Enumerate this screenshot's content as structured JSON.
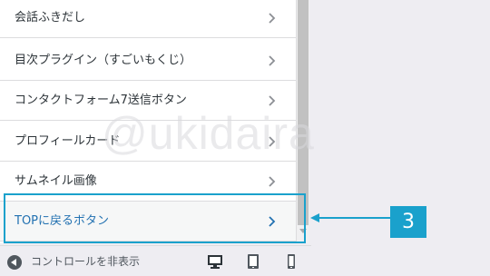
{
  "menu": {
    "items": [
      {
        "label": "会話ふきだし"
      },
      {
        "label": "目次プラグイン（すごいもくじ）"
      },
      {
        "label": "コンタクトフォーム7送信ボタン"
      },
      {
        "label": "プロフィールカード"
      },
      {
        "label": "サムネイル画像"
      },
      {
        "label": "TOPに戻るボタン"
      }
    ],
    "active_index": 5
  },
  "annotation": {
    "step_number": "3",
    "color": "#1aa1cc"
  },
  "watermark": {
    "text": "@ukidaira"
  },
  "footer": {
    "collapse_label": "コントロールを非表示",
    "devices": [
      "desktop-icon",
      "tablet-icon",
      "mobile-icon"
    ]
  },
  "colors": {
    "active_text": "#2271b1",
    "text": "#2c3338",
    "background": "#eeedf2"
  }
}
